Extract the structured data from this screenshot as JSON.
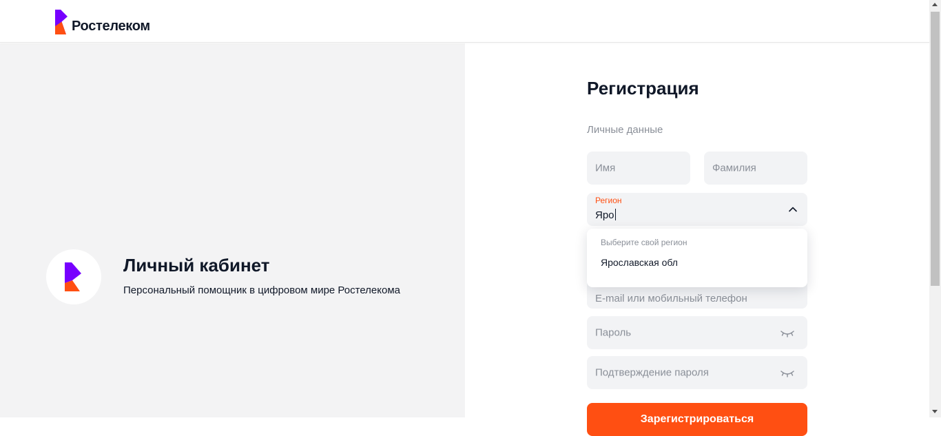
{
  "header": {
    "logo_text": "Ростелеком",
    "logo_icon": "rostelecom-logo-icon"
  },
  "promo": {
    "icon": "rostelecom-logo-icon",
    "title": "Личный кабинет",
    "subtitle": "Персональный помощник в цифровом мире Ростелекома"
  },
  "form": {
    "title": "Регистрация",
    "section_label": "Личные данные",
    "name_placeholder": "Имя",
    "surname_placeholder": "Фамилия",
    "region_label": "Регион",
    "region_value": "Яро",
    "region_icon": "chevron-up-icon",
    "dropdown": {
      "hint": "Выберите свой регион",
      "options": [
        "Ярославская обл"
      ]
    },
    "email_placeholder": "E-mail или мобильный телефон",
    "password_placeholder": "Пароль",
    "password_confirm_placeholder": "Подтверждение пароля",
    "eye_icon": "eye-closed-icon",
    "submit_label": "Зарегистрироваться"
  },
  "colors": {
    "accent": "#ff4f12",
    "brand_purple": "#7700ff",
    "panel_bg": "#f3f3f4",
    "field_bg": "#f2f3f5",
    "text": "#101828",
    "muted": "#8a8f98"
  }
}
